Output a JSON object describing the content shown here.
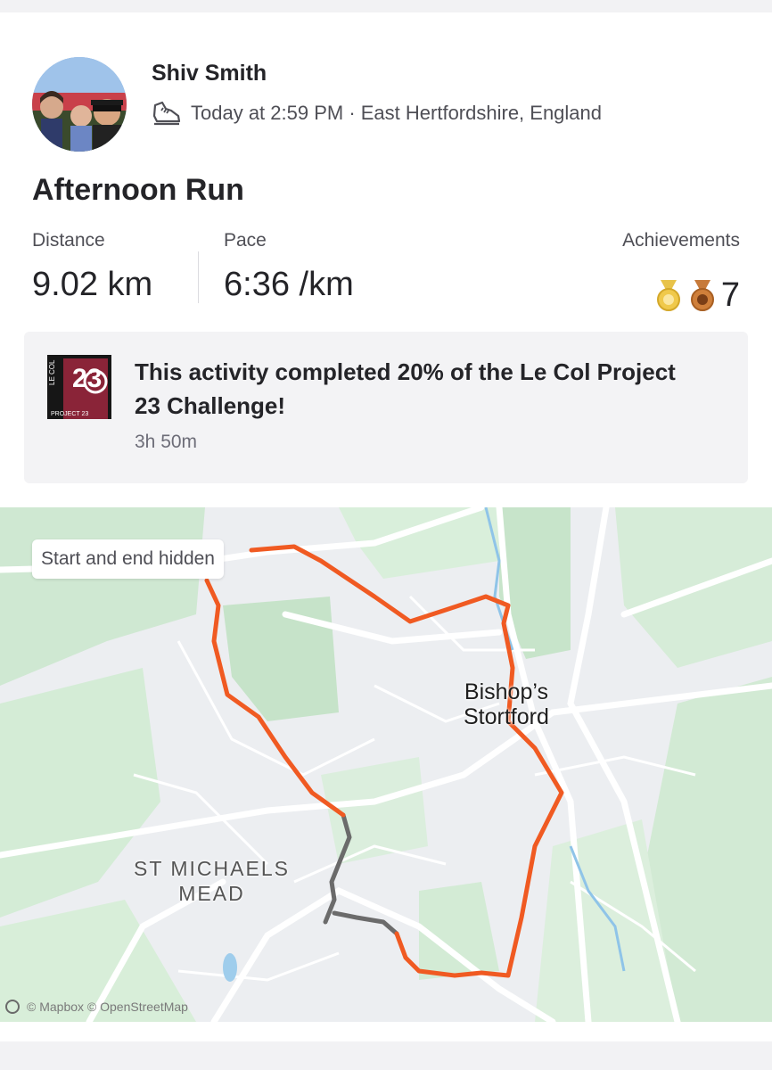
{
  "athlete": {
    "name": "Shiv Smith",
    "meta": "Today at 2:59 PM · East Hertfordshire, England"
  },
  "activity": {
    "title": "Afternoon Run",
    "stats": {
      "distance_label": "Distance",
      "distance_value": "9.02 km",
      "pace_label": "Pace",
      "pace_value": "6:36 /km",
      "achievements_label": "Achievements",
      "achievements_count": "7"
    }
  },
  "challenge": {
    "text": "This activity completed 20% of the Le Col Project 23 Challenge!",
    "time": "3h 50m",
    "badge_top": "LE COL",
    "badge_bottom": "PROJECT 23"
  },
  "map": {
    "hidden_label": "Start and end hidden",
    "town_main_line1": "Bishop’s",
    "town_main_line2": "Stortford",
    "town_small_line1": "ST MICHAELS",
    "town_small_line2": "MEAD",
    "attribution": "© Mapbox © OpenStreetMap",
    "route_color": "#f05a22",
    "hidden_route_color": "#6b6b6b"
  },
  "icons": {
    "activity_type": "running-shoe-icon",
    "medals": [
      "gold-medal-icon",
      "bronze-medal-icon"
    ]
  }
}
